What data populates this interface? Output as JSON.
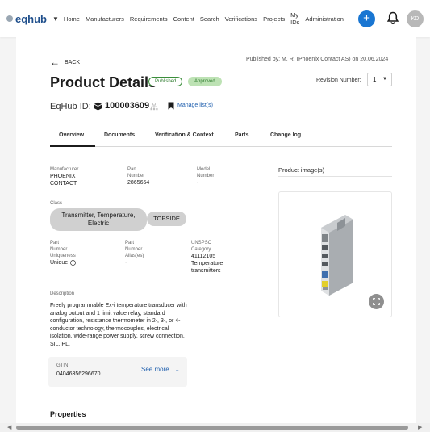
{
  "nav": {
    "logo": "eqhub",
    "items": [
      "Home",
      "Manufacturers",
      "Requirements",
      "Content",
      "Search",
      "Verifications",
      "Projects"
    ],
    "my_ids": [
      "My",
      "IDs"
    ],
    "admin": "Administration",
    "plus": "+",
    "avatar": "KD"
  },
  "header": {
    "back": "BACK",
    "published_by": "Published by: M. R. (Phoenix Contact AS) on 20.06.2024",
    "title": "Product Details",
    "badge_published": "Published",
    "badge_approved": "Approved",
    "revision_label": "Revision Number:",
    "revision_value": "1",
    "eqhub_label": "EqHub ID:",
    "eqhub_id": "100003609",
    "manage_lists": "Manage list(s)"
  },
  "tabs": [
    "Overview",
    "Documents",
    "Verification & Context",
    "Parts",
    "Change log"
  ],
  "details": {
    "manufacturer_label": "Manufacturer",
    "manufacturer_value": [
      "PHOENIX",
      "CONTACT"
    ],
    "part_number_label": [
      "Part",
      "Number"
    ],
    "part_number_value": "2865654",
    "model_number_label": [
      "Model",
      "Number"
    ],
    "model_number_value": "-",
    "class_label": "Class",
    "class_chip_1": [
      "Transmitter, Temperature,",
      "Electric"
    ],
    "class_chip_2": "TOPSIDE",
    "uniqueness_label": [
      "Part",
      "Number",
      "Uniqueness"
    ],
    "uniqueness_value": "Unique",
    "alias_label": [
      "Part",
      "Number",
      "Alias(es)"
    ],
    "alias_value": "-",
    "unspsc_label": [
      "UNSPSC",
      "Category"
    ],
    "unspsc_value": [
      "41112105",
      "Temperature",
      "transmitters"
    ],
    "description_label": "Description",
    "description_value": "Freely programmable Ex-i temperature transducer with analog output and 1 limit value relay, standard configuration, resistance thermometer in 2-, 3-, or 4-conductor technology, thermocouples, electrical isolation, wide-range power supply, screw connection, SIL, PL.",
    "gtin_label": "GTIN",
    "gtin_value": "04046356296670",
    "see_more": "See more"
  },
  "image_section": {
    "title": "Product image(s)"
  },
  "properties_title": "Properties",
  "colors": {
    "accent": "#1976d2",
    "link": "#1f5fae",
    "approved_bg": "#bde2b4",
    "published": "#2c7a2c"
  }
}
